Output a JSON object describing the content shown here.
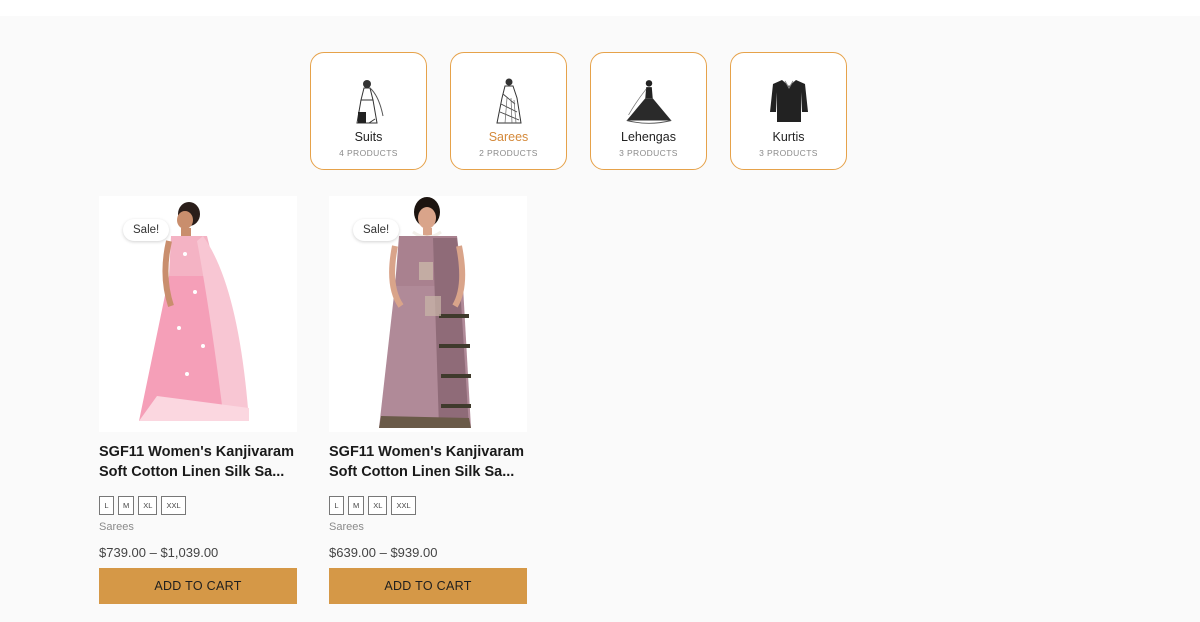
{
  "categories": [
    {
      "name": "Suits",
      "count": "4 PRODUCTS",
      "icon": "suit-icon"
    },
    {
      "name": "Sarees",
      "count": "2 PRODUCTS",
      "icon": "saree-icon",
      "active": true
    },
    {
      "name": "Lehengas",
      "count": "3 PRODUCTS",
      "icon": "lehenga-icon"
    },
    {
      "name": "Kurtis",
      "count": "3 PRODUCTS",
      "icon": "kurti-icon"
    }
  ],
  "products": [
    {
      "badge": "Sale!",
      "title": "SGF11 Women's Kanjivaram Soft Cotton Linen Silk Sa...",
      "sizes": [
        "L",
        "M",
        "XL",
        "XXL"
      ],
      "category": "Sarees",
      "price": "$739.00 – $1,039.00",
      "button": "ADD TO CART",
      "image": "pink-saree-model-photo"
    },
    {
      "badge": "Sale!",
      "title": "SGF11 Women's Kanjivaram Soft Cotton Linen Silk Sa...",
      "sizes": [
        "L",
        "M",
        "XL",
        "XXL"
      ],
      "category": "Sarees",
      "price": "$639.00 – $939.00",
      "button": "ADD TO CART",
      "image": "mauve-saree-model-photo"
    }
  ],
  "colors": {
    "accent": "#d59847",
    "card_border": "#e6a24a",
    "active_text": "#d4893a"
  }
}
